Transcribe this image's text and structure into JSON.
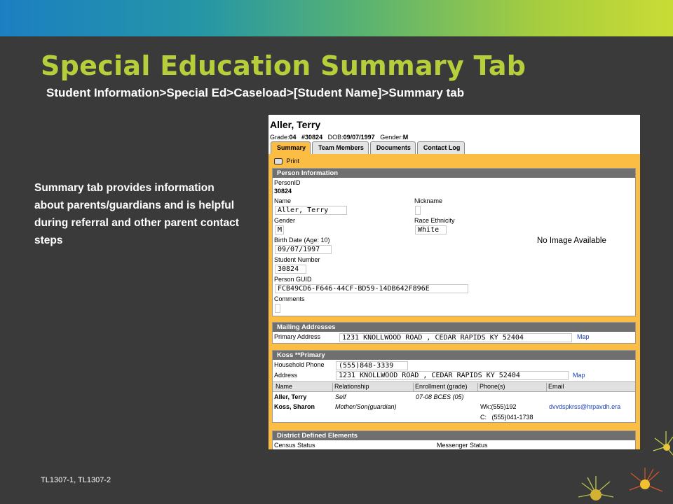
{
  "slide": {
    "title": "Special Education Summary Tab",
    "path": "Student Information>Special Ed>Caseload>[Student Name]>Summary tab",
    "description": "Summary tab provides information about parents/guardians and is helpful during referral and other parent contact steps",
    "footer_ref": "TL1307-1, TL1307-2"
  },
  "colors": {
    "title": "#b5cf3a",
    "panel": "#fbbd44",
    "background": "#3a3a3a"
  },
  "student": {
    "name": "Aller, Terry",
    "grade_label": "Grade:",
    "grade": "04",
    "number": "#30824",
    "dob_label": "DOB:",
    "dob": "09/07/1997",
    "gender_label": "Gender:",
    "gender": "M"
  },
  "tabs": [
    {
      "label": "Summary"
    },
    {
      "label": "Team Members"
    },
    {
      "label": "Documents"
    },
    {
      "label": "Contact Log"
    }
  ],
  "toolbar": {
    "print_label": "Print",
    "print_icon": "printer-icon"
  },
  "person_info": {
    "title": "Person Information",
    "personid_label": "PersonID",
    "personid": "30824",
    "name_label": "Name",
    "name": "Aller, Terry",
    "nickname_label": "Nickname",
    "nickname": "",
    "gender_label": "Gender",
    "gender": "M",
    "race_label": "Race Ethnicity",
    "race": "White",
    "birth_label": "Birth Date (Age: 10)",
    "birth": "09/07/1997",
    "student_number_label": "Student Number",
    "student_number": "30824",
    "guid_label": "Person GUID",
    "guid": "FCB49CD6-F646-44CF-BD59-14DB642F896E",
    "comments_label": "Comments",
    "comments": "",
    "no_image": "No Image Available"
  },
  "mailing": {
    "title": "Mailing Addresses",
    "primary_label": "Primary Address",
    "primary": "1231 KNOLLWOOD ROAD , CEDAR RAPIDS KY 52404",
    "map": "Map"
  },
  "household": {
    "title": "Koss **Primary",
    "phone_label": "Household Phone",
    "phone": "(555)848-3339",
    "address_label": "Address",
    "address": "1231 KNOLLWOOD ROAD , CEDAR RAPIDS KY 52404",
    "map": "Map",
    "columns": [
      "Name",
      "Relationship",
      "Enrollment (grade)",
      "Phone(s)",
      "Email"
    ],
    "rows": [
      {
        "name": "Aller, Terry",
        "relationship": "Self",
        "enrollment": "07-08 BCES (05)",
        "phones": [
          "",
          ""
        ],
        "email": ""
      },
      {
        "name": "Koss, Sharon",
        "relationship": "Mother/Son(guardian)",
        "enrollment": "",
        "phones": [
          "Wk:(555)192",
          "C:   (555)041-1738"
        ],
        "email": "dvvdspkrss@hrpavdh.era"
      }
    ]
  },
  "district": {
    "title": "District Defined Elements",
    "census_label": "Census Status",
    "messenger_label": "Messenger Status"
  }
}
